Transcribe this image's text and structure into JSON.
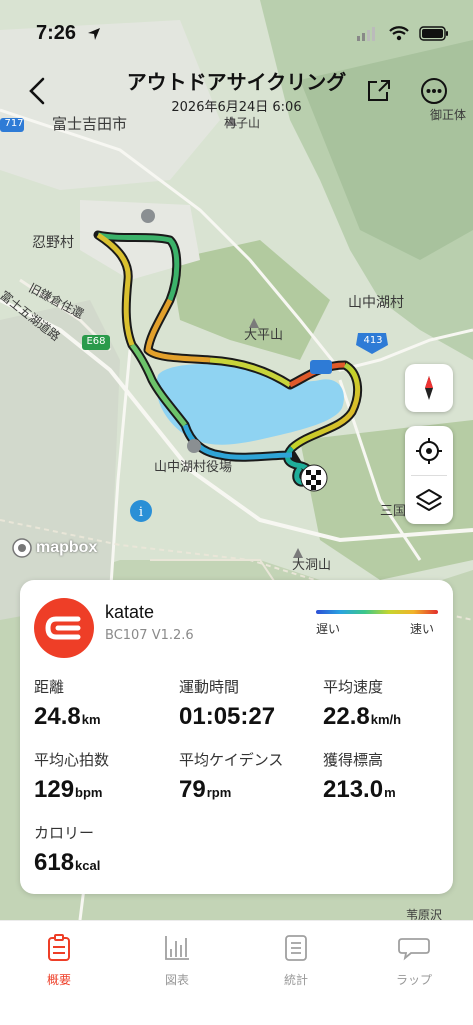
{
  "status": {
    "time": "7:26"
  },
  "header": {
    "title": "アウトドアサイクリング",
    "datetime": "2026年6月24日 6:06"
  },
  "map": {
    "labels": {
      "fujiyoshida": "富士吉田市",
      "murakoyama": "杓子山",
      "oshino": "忍野村",
      "kyukamakura": "旧鎌倉住還",
      "fujigoko": "富士五湖道路",
      "yamanakako_village": "山中湖村",
      "ohirayama": "大平山",
      "yamanakako_office": "山中湖村役場",
      "mikuni": "三国",
      "ohorayama": "大洞山",
      "misaka": "御正体",
      "sakaizawa": "苇原沢",
      "route_717": "717",
      "route_e68": "E68",
      "route_413": "413"
    },
    "attribution": "mapbox"
  },
  "summary": {
    "device_name": "katate",
    "device_model": "BC107  V1.2.6",
    "legend_slow": "遅い",
    "legend_fast": "速い",
    "stats": [
      {
        "label": "距離",
        "value": "24.8",
        "unit": "km"
      },
      {
        "label": "運動時間",
        "value": "01:05:27",
        "unit": ""
      },
      {
        "label": "平均速度",
        "value": "22.8",
        "unit": "km/h"
      },
      {
        "label": "平均心拍数",
        "value": "129",
        "unit": "bpm"
      },
      {
        "label": "平均ケイデンス",
        "value": "79",
        "unit": "rpm"
      },
      {
        "label": "獲得標高",
        "value": "213.0",
        "unit": "m"
      },
      {
        "label": "カロリー",
        "value": "618",
        "unit": "kcal"
      }
    ]
  },
  "tabs": [
    {
      "label": "概要",
      "icon": "summary-icon",
      "active": true
    },
    {
      "label": "図表",
      "icon": "chart-icon",
      "active": false
    },
    {
      "label": "統計",
      "icon": "list-icon",
      "active": false
    },
    {
      "label": "ラップ",
      "icon": "lap-icon",
      "active": false
    }
  ],
  "colors": {
    "accent": "#ee3e27",
    "lake": "#8fd3f2",
    "card": "#ffffff"
  }
}
